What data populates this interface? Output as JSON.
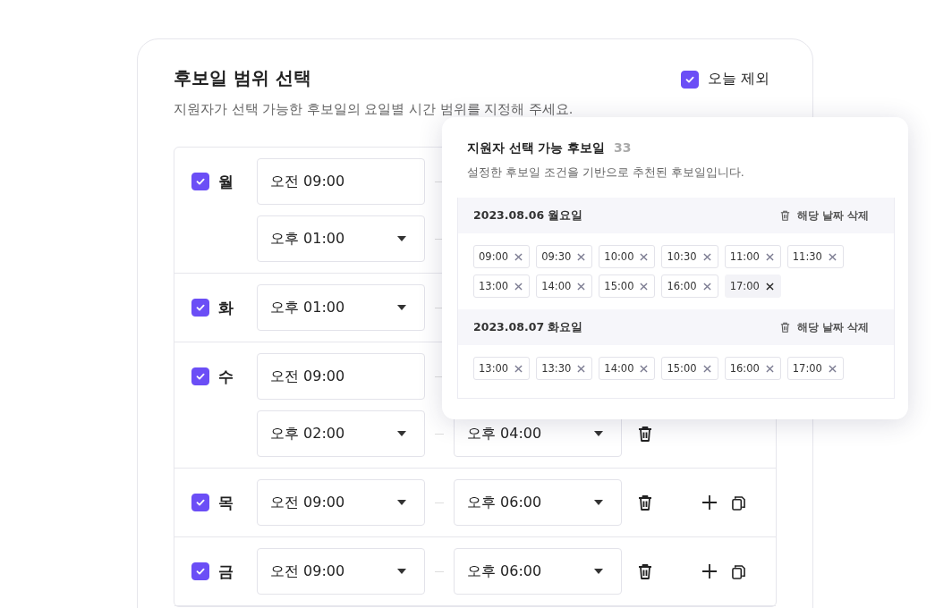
{
  "card": {
    "title": "후보일 범위 선택",
    "subtitle": "지원자가 선택 가능한 후보일의 요일별 시간 범위를 지정해 주세요.",
    "exclude_today": {
      "label": "오늘 제외",
      "checked": true
    }
  },
  "days": [
    {
      "label": "월",
      "checked": true,
      "actions": false,
      "slots": [
        {
          "start": "오전 09:00",
          "start_dropdown": false
        },
        {
          "start": "오후 01:00",
          "start_dropdown": true
        }
      ]
    },
    {
      "label": "화",
      "checked": true,
      "actions": false,
      "slots": [
        {
          "start": "오후 01:00",
          "start_dropdown": true
        }
      ]
    },
    {
      "label": "수",
      "checked": true,
      "actions": false,
      "slots": [
        {
          "start": "오전 09:00",
          "start_dropdown": false
        },
        {
          "start": "오후 02:00",
          "start_dropdown": true,
          "end": "오후 04:00"
        }
      ]
    },
    {
      "label": "목",
      "checked": true,
      "actions": true,
      "slots": [
        {
          "start": "오전 09:00",
          "start_dropdown": true,
          "end": "오후 06:00"
        }
      ]
    },
    {
      "label": "금",
      "checked": true,
      "actions": true,
      "slots": [
        {
          "start": "오전 09:00",
          "start_dropdown": true,
          "end": "오후 06:00"
        }
      ]
    }
  ],
  "popup": {
    "title": "지원자 선택 가능 후보일",
    "count": "33",
    "subtitle": "설정한 후보일 조건을 기반으로 추천된 후보일입니다.",
    "dates": [
      {
        "date": "2023.08.06 월요일",
        "delete_label": "해당 날짜 삭제",
        "times": [
          {
            "time": "09:00",
            "selected": false
          },
          {
            "time": "09:30",
            "selected": false
          },
          {
            "time": "10:00",
            "selected": false
          },
          {
            "time": "10:30",
            "selected": false
          },
          {
            "time": "11:00",
            "selected": false
          },
          {
            "time": "11:30",
            "selected": false
          },
          {
            "time": "13:00",
            "selected": false
          },
          {
            "time": "14:00",
            "selected": false
          },
          {
            "time": "15:00",
            "selected": false
          },
          {
            "time": "16:00",
            "selected": false
          },
          {
            "time": "17:00",
            "selected": true
          }
        ]
      },
      {
        "date": "2023.08.07 화요일",
        "delete_label": "해당 날짜 삭제",
        "times": [
          {
            "time": "13:00",
            "selected": false
          },
          {
            "time": "13:30",
            "selected": false
          },
          {
            "time": "14:00",
            "selected": false
          },
          {
            "time": "15:00",
            "selected": false
          },
          {
            "time": "16:00",
            "selected": false
          },
          {
            "time": "17:00",
            "selected": false
          }
        ]
      }
    ]
  }
}
